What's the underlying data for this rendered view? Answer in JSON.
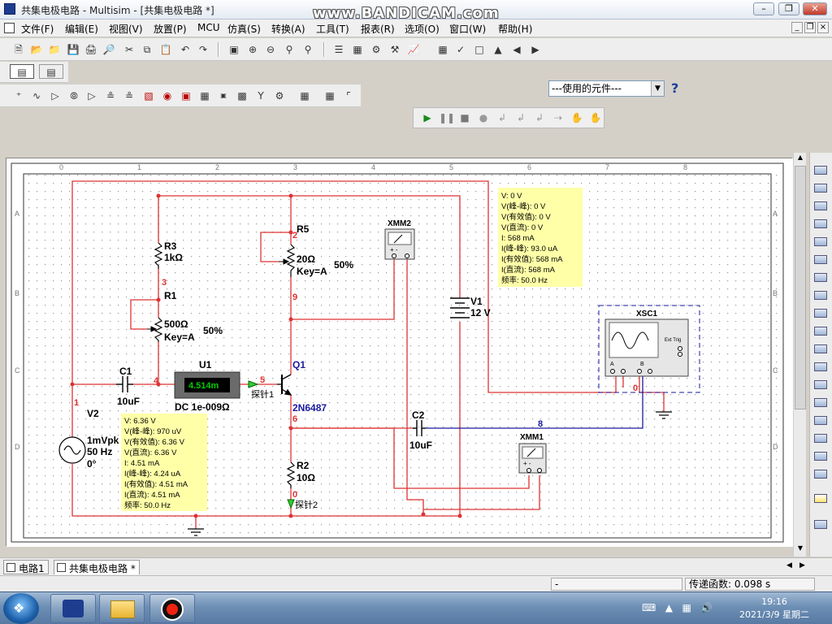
{
  "window": {
    "title": "共集电极电路 - Multisim - [共集电极电路 *]"
  },
  "watermark": "www.BANDICAM.com",
  "menu": [
    "文件(F)",
    "编辑(E)",
    "视图(V)",
    "放置(P)",
    "MCU",
    "仿真(S)",
    "转换(A)",
    "工具(T)",
    "报表(R)",
    "选项(O)",
    "窗口(W)",
    "帮助(H)"
  ],
  "toolbar": {
    "component_select": "---使用的元件---",
    "help": "?"
  },
  "ruler": {
    "top": [
      "0",
      "1",
      "2",
      "3",
      "4",
      "5",
      "6",
      "7",
      "8"
    ],
    "side": [
      "A",
      "B",
      "C",
      "D"
    ]
  },
  "schematic": {
    "labels": {
      "r3": "R3",
      "r3_value": "1kΩ",
      "r1": "R1",
      "r1_value": "500Ω",
      "r1_key": "Key=A",
      "r1_pct": "50%",
      "r5": "R5",
      "r5_value": "20Ω",
      "r5_key": "Key=A",
      "r5_pct": "50%",
      "c1": "C1",
      "c1_value": "10uF",
      "c2": "C2",
      "c2_value": "10uF",
      "u1": "U1",
      "u1_reading": "4.514m",
      "u1_mode": "DC  1e-009Ω",
      "q1": "Q1",
      "q1_model": "2N6487",
      "r2": "R2",
      "r2_value": "10Ω",
      "v1": "V1",
      "v1_value": "12 V",
      "v2": "V2",
      "v2_amp": "1mVpk",
      "v2_freq": "50 Hz",
      "v2_phase": "0°",
      "xmm2": "XMM2",
      "xmm1": "XMM1",
      "xsc1": "XSC1",
      "ext_trig": "Ext Trig",
      "ch_a": "A",
      "ch_b": "B",
      "probe1": "探针1",
      "probe2": "探针2"
    },
    "nets": {
      "n1": "1",
      "n2": "2",
      "n3": "3",
      "n4": "4",
      "n5": "5",
      "n6": "6",
      "n8": "8",
      "n9": "9",
      "n0a": "0",
      "n0b": "0"
    },
    "probe_boxes": [
      {
        "lines": [
          "V: 0 V",
          "V(峰-峰): 0 V",
          "V(有效值): 0 V",
          "V(直流): 0 V",
          "I: 568 mA",
          "I(峰-峰): 93.0 uA",
          "I(有效值): 568 mA",
          "I(直流): 568 mA",
          "频率: 50.0 Hz"
        ]
      },
      {
        "lines": [
          "V: 6.36 V",
          "V(峰-峰): 970 uV",
          "V(有效值): 6.36 V",
          "V(直流): 6.36 V",
          "I: 4.51 mA",
          "I(峰-峰): 4.24 uA",
          "I(有效值): 4.51 mA",
          "I(直流): 4.51 mA",
          "频率: 50.0 Hz"
        ]
      }
    ]
  },
  "tabs": [
    {
      "label": "电路1"
    },
    {
      "label": "共集电极电路 *"
    }
  ],
  "status": {
    "left": "-",
    "transfer": "传递函数: 0.098 s"
  },
  "taskbar": {
    "time": "19:16",
    "date": "2021/3/9 星期二"
  }
}
